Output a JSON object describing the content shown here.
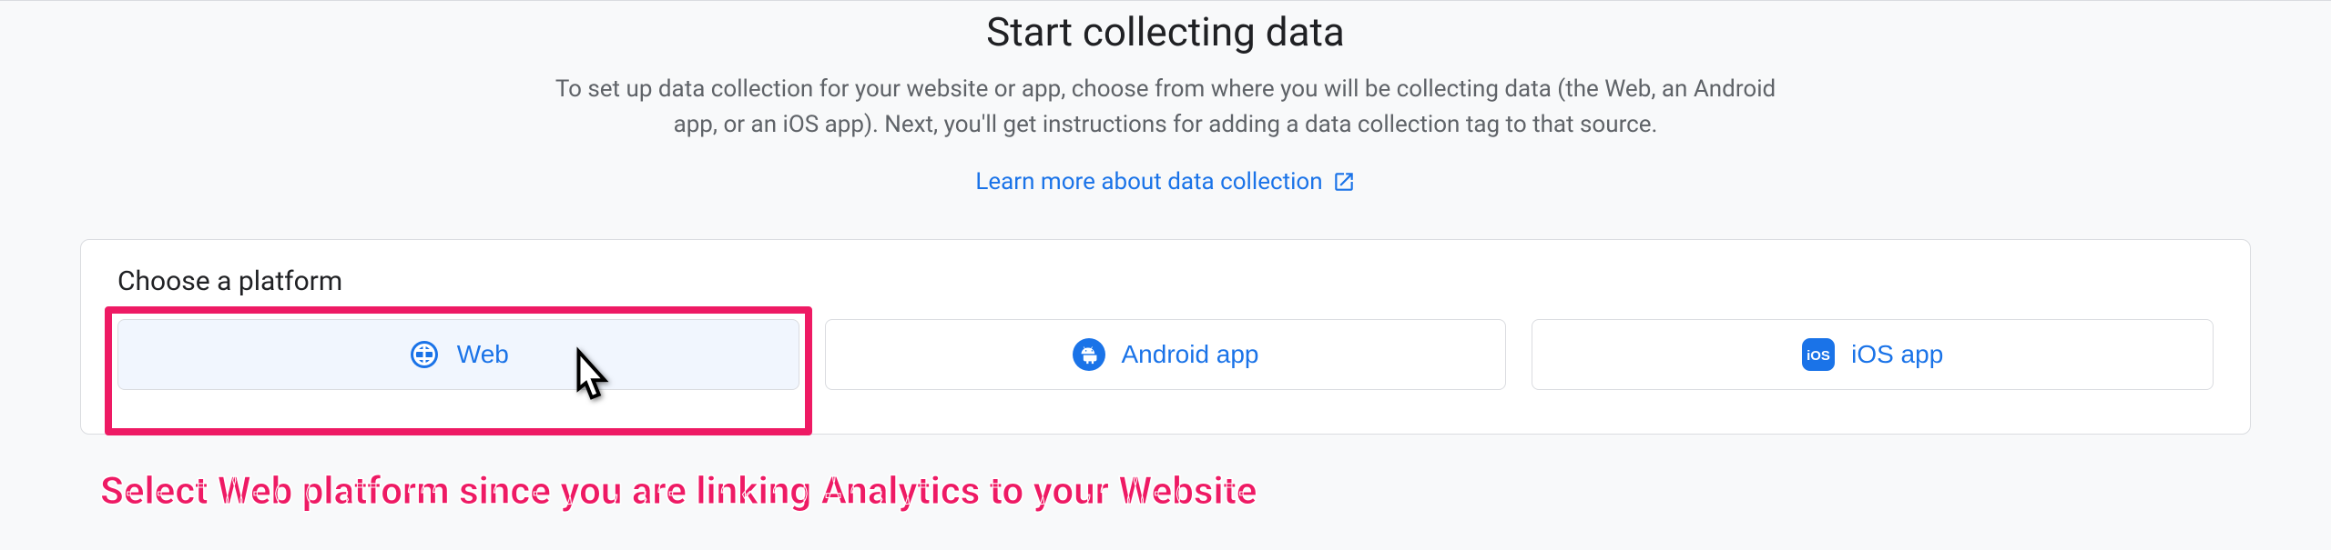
{
  "header": {
    "title": "Start collecting data",
    "description": "To set up data collection for your website or app, choose from where you will be collecting data (the Web, an Android app, or an iOS app). Next, you'll get instructions for adding a data collection tag to that source.",
    "learn_more_label": "Learn more about data collection"
  },
  "card": {
    "title": "Choose a platform",
    "platforms": [
      {
        "label": "Web"
      },
      {
        "label": "Android app"
      },
      {
        "label": "iOS app"
      }
    ]
  },
  "annotation": {
    "text": "Select Web platform since you are linking Analytics  to your Website"
  }
}
